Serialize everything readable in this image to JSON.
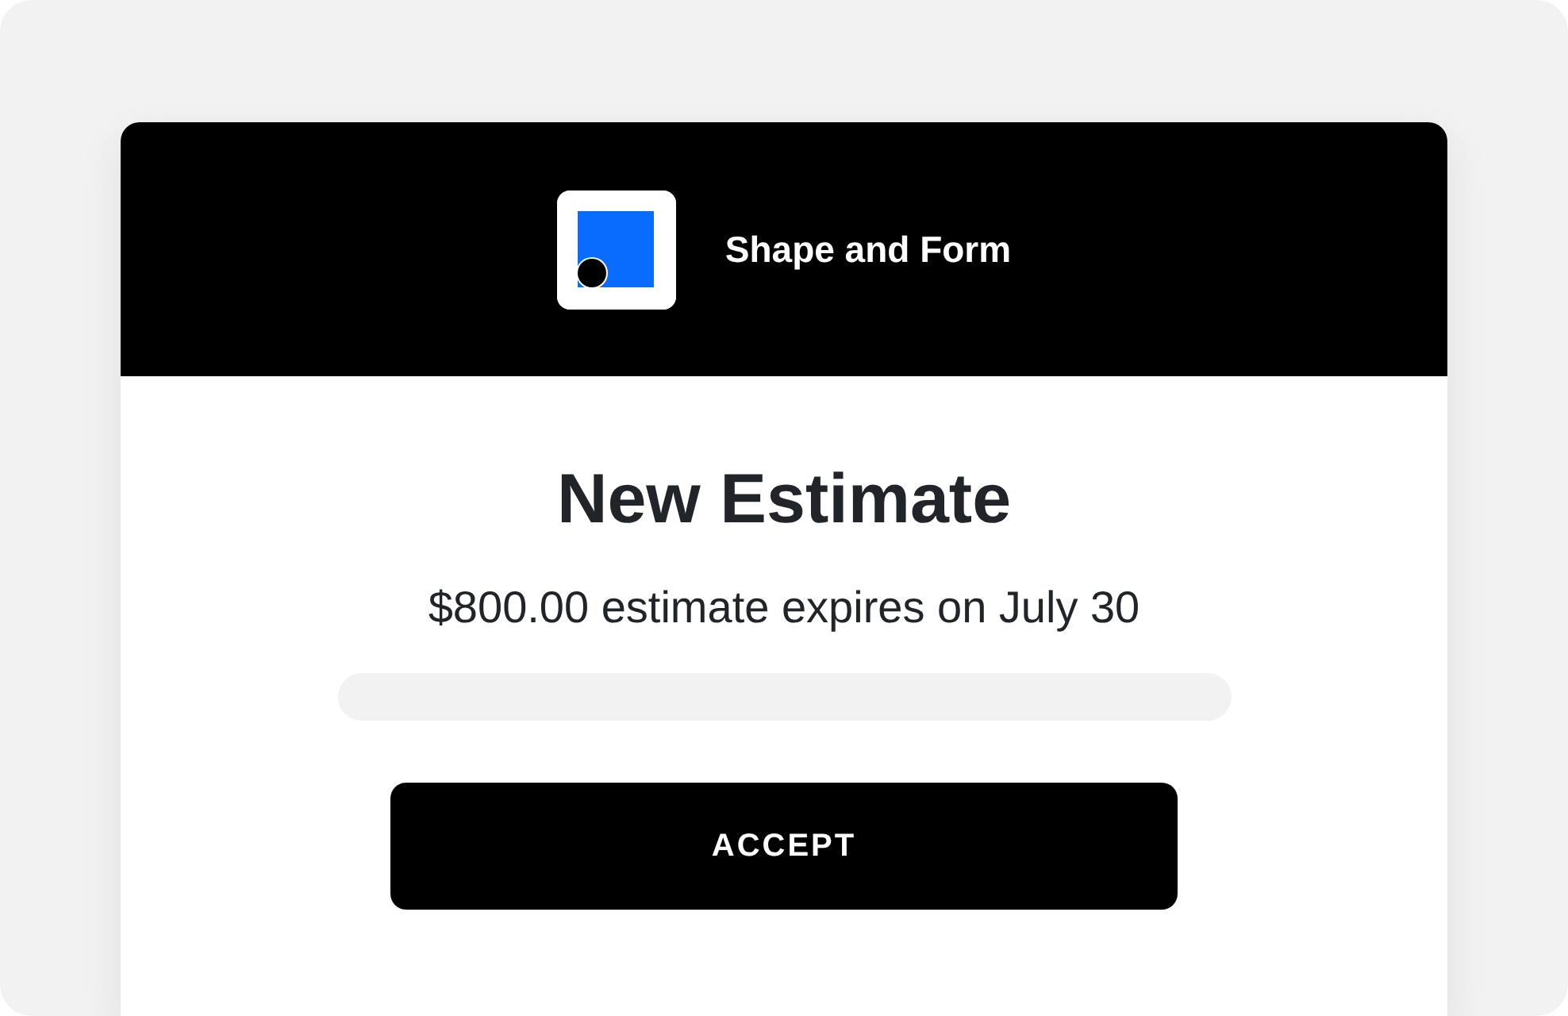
{
  "header": {
    "business_name": "Shape and Form"
  },
  "estimate": {
    "title": "New Estimate",
    "summary": "$800.00 estimate expires on July 30"
  },
  "buttons": [
    {
      "label": "ACCEPT"
    }
  ]
}
